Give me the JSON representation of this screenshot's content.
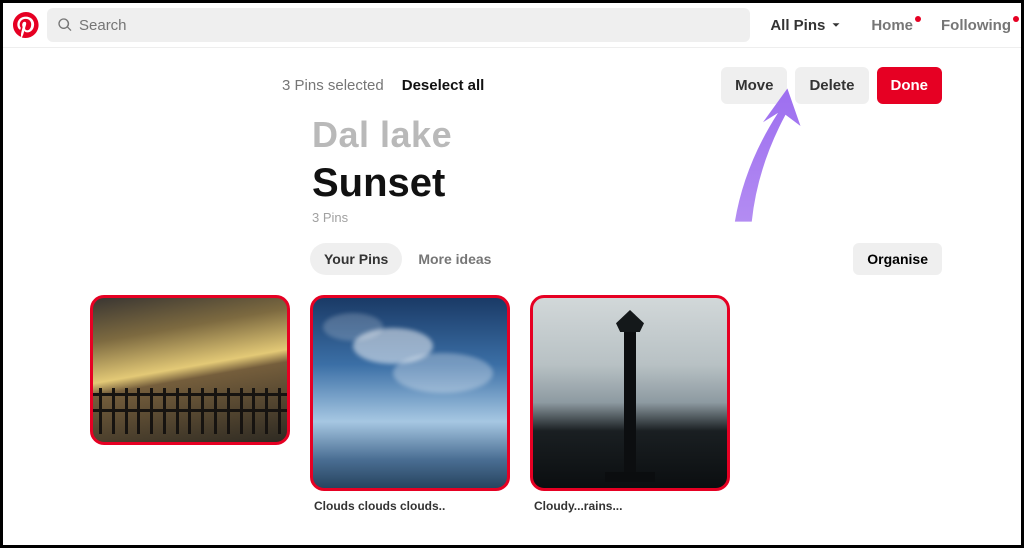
{
  "header": {
    "search_placeholder": "Search",
    "filter_label": "All Pins",
    "nav_home": "Home",
    "nav_following": "Following"
  },
  "selection": {
    "count_text": "3 Pins selected",
    "deselect_label": "Deselect all",
    "move_label": "Move",
    "delete_label": "Delete",
    "done_label": "Done"
  },
  "board": {
    "name": "Dal lake",
    "section": "Sunset",
    "count_text": "3 Pins"
  },
  "tabs": {
    "your_pins": "Your Pins",
    "more_ideas": "More ideas",
    "organise": "Organise"
  },
  "pins": [
    {
      "caption": ""
    },
    {
      "caption": "Clouds clouds clouds.."
    },
    {
      "caption": "Cloudy...rains..."
    }
  ]
}
